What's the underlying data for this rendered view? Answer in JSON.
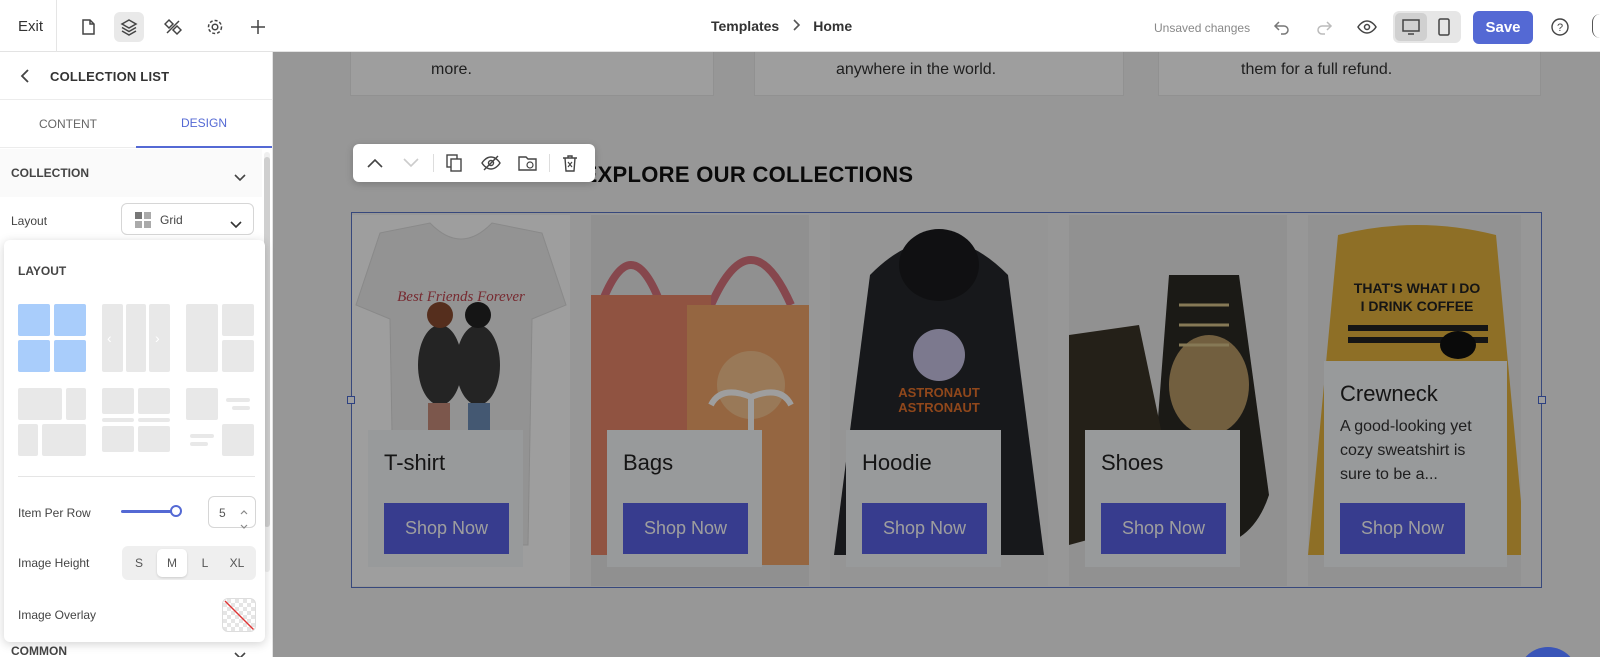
{
  "topbar": {
    "exit_label": "Exit",
    "breadcrumb": {
      "parent": "Templates",
      "current": "Home"
    },
    "status": "Unsaved changes",
    "save_label": "Save",
    "help_label": "?"
  },
  "panel": {
    "title": "COLLECTION LIST",
    "tabs": [
      "CONTENT",
      "DESIGN"
    ],
    "active_tab": "DESIGN",
    "section_title": "COLLECTION",
    "layout_label": "Layout",
    "layout_value": "Grid",
    "popover": {
      "title": "LAYOUT",
      "item_per_row_label": "Item Per Row",
      "item_per_row_value": "5",
      "image_height_label": "Image Height",
      "image_height_options": [
        "S",
        "M",
        "L",
        "XL"
      ],
      "image_height_selected": "M",
      "image_overlay_label": "Image Overlay"
    },
    "common_title": "COMMON"
  },
  "canvas": {
    "feature_texts": [
      "more.",
      "anywhere in the world.",
      "them for a full refund."
    ],
    "section_heading": "EXPLORE OUR COLLECTIONS",
    "collections": [
      {
        "title": "T-shirt",
        "button": "Shop Now"
      },
      {
        "title": "Bags",
        "button": "Shop Now"
      },
      {
        "title": "Hoodie",
        "button": "Shop Now"
      },
      {
        "title": "Shoes",
        "button": "Shop Now"
      },
      {
        "title": "Crewneck",
        "description": "A good-looking yet cozy sweatshirt is sure to be a...",
        "button": "Shop Now"
      }
    ]
  },
  "colors": {
    "accent": "#5469d4",
    "button": "#5a62e6",
    "selection": "#a9cdfb"
  }
}
